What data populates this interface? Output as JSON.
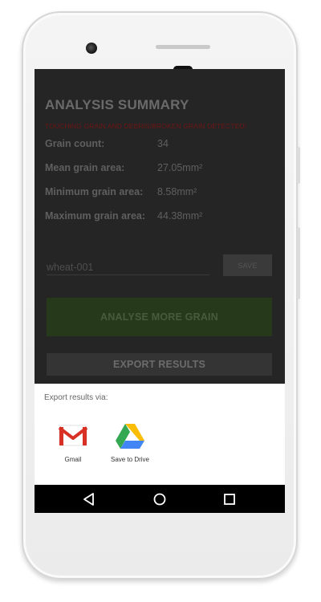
{
  "summary": {
    "title": "ANALYSIS SUMMARY",
    "warning": "TOUCHING GRAIN AND DEBRIS/BROKEN GRAIN DETECTED!",
    "stats": [
      {
        "label": "Grain count:",
        "value": "34"
      },
      {
        "label": "Mean grain area:",
        "value": "27.05mm²"
      },
      {
        "label": "Minimum grain area:",
        "value": "8.58mm²"
      },
      {
        "label": "Maximum grain area:",
        "value": "44.38mm²"
      }
    ]
  },
  "sample": {
    "name_placeholder": "wheat-001",
    "save_label": "SAVE"
  },
  "actions": {
    "analyse_label": "ANALYSE MORE GRAIN",
    "export_label": "EXPORT RESULTS"
  },
  "share_sheet": {
    "title": "Export results via:",
    "targets": [
      {
        "label": "Gmail",
        "icon": "gmail-icon"
      },
      {
        "label": "Save to Drive",
        "icon": "google-drive-icon"
      }
    ]
  },
  "navigation": {
    "icons": [
      "back-icon",
      "home-icon",
      "recents-icon"
    ]
  },
  "colors": {
    "warning": "#6e1515",
    "analyse_button": "#263a1b",
    "overlay_background": "#252525",
    "sheet_background": "#ffffff"
  }
}
